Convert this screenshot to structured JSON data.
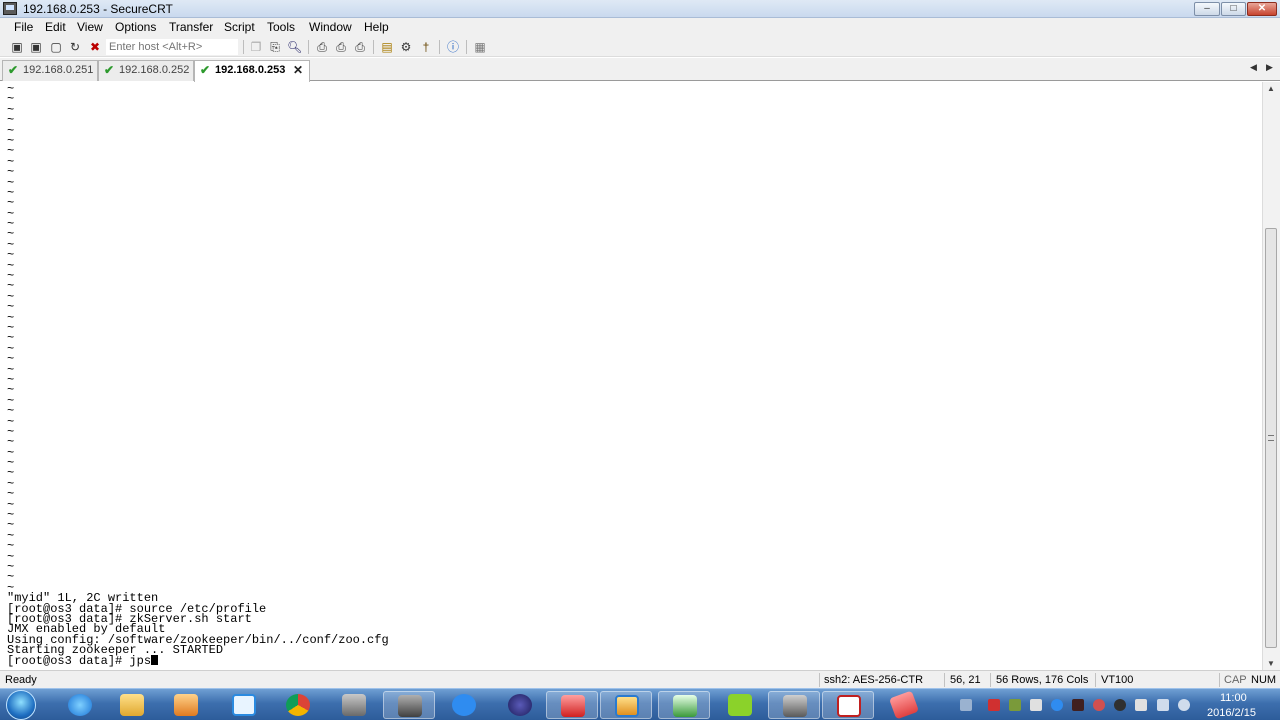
{
  "window": {
    "title": "192.168.0.253 - SecureCRT"
  },
  "menu": [
    "File",
    "Edit",
    "View",
    "Options",
    "Transfer",
    "Script",
    "Tools",
    "Window",
    "Help"
  ],
  "toolbar": {
    "host_placeholder": "Enter host <Alt+R>"
  },
  "tabs": [
    {
      "label": "192.168.0.251",
      "active": false
    },
    {
      "label": "192.168.0.252",
      "active": false
    },
    {
      "label": "192.168.0.253",
      "active": true
    }
  ],
  "terminal": {
    "tilde": "~",
    "tilde_count": 49,
    "lines": [
      "\"myid\" 1L, 2C written",
      "[root@os3 data]# source /etc/profile",
      "[root@os3 data]# zkServer.sh start",
      "JMX enabled by default",
      "Using config: /software/zookeeper/bin/../conf/zoo.cfg",
      "Starting zookeeper ... STARTED"
    ],
    "prompt": "[root@os3 data]# jps"
  },
  "status": {
    "ready": "Ready",
    "cipher": "ssh2: AES-256-CTR",
    "position": "56,  21",
    "size": "56 Rows, 176 Cols",
    "emulation": "VT100",
    "caps": "CAP",
    "num": "NUM"
  },
  "taskbar": {
    "time": "11:00",
    "date": "2016/2/15"
  },
  "colors": {
    "tab_check": "#2e9a2e",
    "taskbar": "#3d6fae"
  }
}
